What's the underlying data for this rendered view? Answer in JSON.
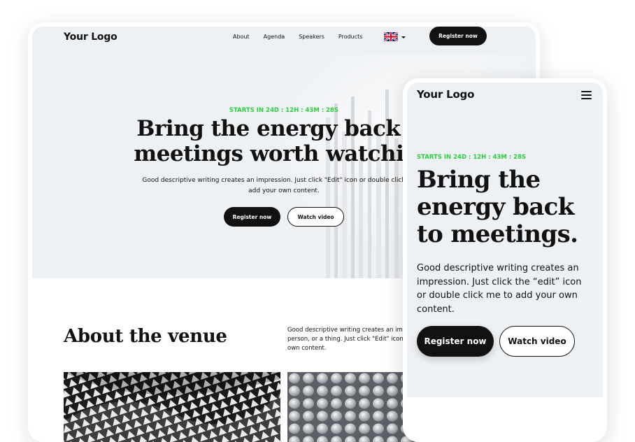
{
  "desktop": {
    "logo": "Your Logo",
    "nav": [
      "About",
      "Agenda",
      "Speakers",
      "Products"
    ],
    "language_flag": "uk-flag-icon",
    "register_label": "Register now",
    "countdown": "STARTS IN 24D : 12H : 43M : 28S",
    "title_line1": "Bring the energy back to",
    "title_line2": "meetings worth watching",
    "description": "Good descriptive writing creates an impression. Just click \"Edit\" icon or double click me to add your own content.",
    "primary_cta": "Register now",
    "secondary_cta": "Watch video",
    "about": {
      "title": "About the venue",
      "text": "Good descriptive writing creates an impression of an event, a place, a person, or a thing. Just click \"Edit\" icon or double click me to add your own content."
    }
  },
  "mobile": {
    "logo": "Your Logo",
    "menu_icon": "hamburger-menu-icon",
    "countdown": "STARTS IN 24D : 12H : 43M : 28S",
    "title": "Bring the energy back to meetings.",
    "description": "Good descriptive writing creates an impression. Just click the “edit” icon or double click me to add your own content.",
    "primary_cta": "Register now",
    "secondary_cta": "Watch video"
  },
  "colors": {
    "accent_green": "#2ecc40",
    "dark": "#111111",
    "hero_bg": "#eef1f4"
  }
}
